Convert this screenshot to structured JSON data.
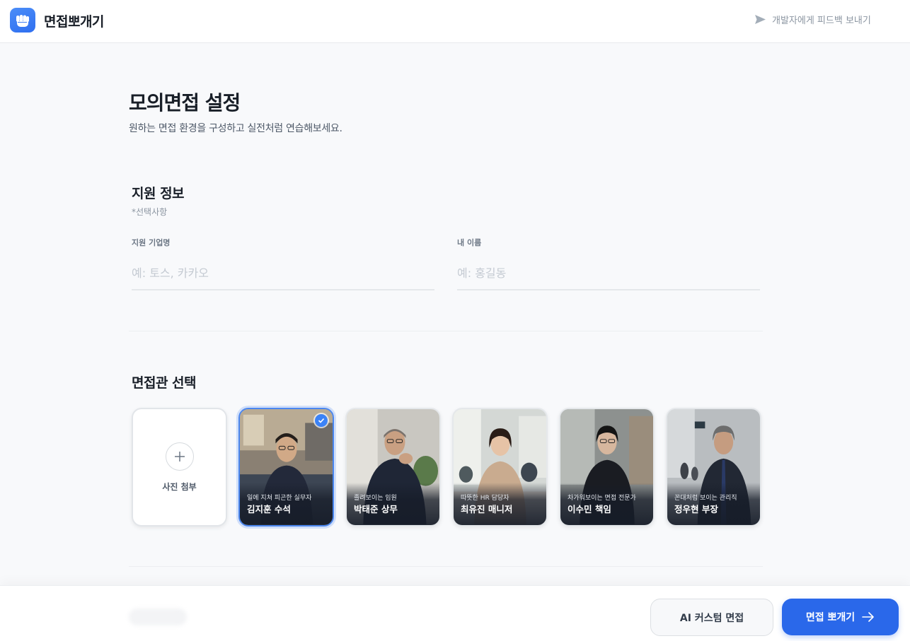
{
  "header": {
    "brand": "면접뽀개기",
    "feedback_label": "개발자에게 피드백 보내기"
  },
  "main": {
    "title": "모의면접 설정",
    "subtitle": "원하는 면접 환경을 구성하고 실전처럼 연습해보세요."
  },
  "applicant": {
    "section_title": "지원 정보",
    "optional_note": "*선택사항",
    "company": {
      "label": "지원 기업명",
      "placeholder": "예: 토스, 카카오",
      "value": ""
    },
    "name": {
      "label": "내 이름",
      "placeholder": "예: 홍길동",
      "value": ""
    }
  },
  "interviewers": {
    "section_title": "면접관 선택",
    "upload_label": "사진 첨부",
    "selected_index": 0,
    "items": [
      {
        "desc": "일에 지쳐 피곤한 실무자",
        "name": "김지훈 수석"
      },
      {
        "desc": "졸려보이는 임원",
        "name": "박태준 상무"
      },
      {
        "desc": "따뜻한 HR 담당자",
        "name": "최유진 매니저"
      },
      {
        "desc": "차가워보이는 면접 전문가",
        "name": "이수민 책임"
      },
      {
        "desc": "꼰대처럼 보이는 관리직",
        "name": "정우현 부장"
      }
    ]
  },
  "footer": {
    "custom_button": "AI 커스텀 면접",
    "start_button": "면접 뽀개기"
  },
  "colors": {
    "primary": "#2a68ea",
    "selected_border": "#4a86f0",
    "text": "#191f28",
    "muted": "#8b95a1"
  }
}
